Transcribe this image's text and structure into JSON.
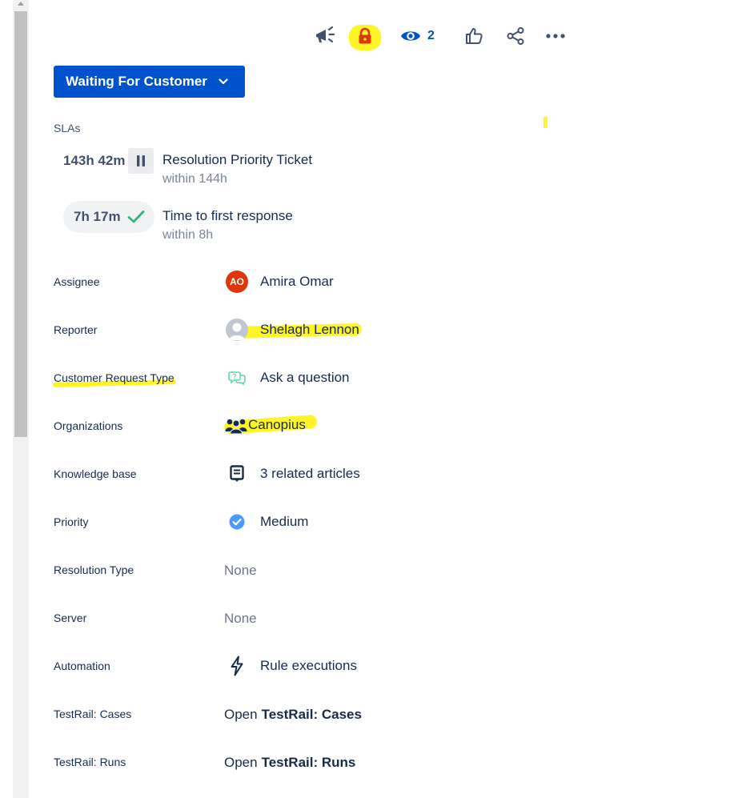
{
  "toolbar": {
    "items": [
      {
        "icon": "megaphone-icon"
      },
      {
        "icon": "lock-icon",
        "color": "#de350b"
      },
      {
        "icon": "eye-icon",
        "count": "2"
      },
      {
        "icon": "thumbs-up-icon"
      },
      {
        "icon": "share-icon"
      },
      {
        "icon": "more-icon"
      }
    ],
    "highlight_color": "#fff200"
  },
  "status": {
    "label": "Waiting For Customer",
    "color": "#0052cc"
  },
  "slas": {
    "title": "SLAs",
    "items": [
      {
        "time": "143h 42m",
        "name": "Resolution Priority Ticket",
        "target": "within 144h",
        "state": "paused"
      },
      {
        "time": "7h 17m",
        "name": "Time to first response",
        "target": "within 8h",
        "state": "met"
      }
    ]
  },
  "fields": {
    "assignee": {
      "label": "Assignee",
      "value": "Amira Omar",
      "initials": "AO",
      "avatar_color": "#de350b"
    },
    "reporter": {
      "label": "Reporter",
      "value": "Shelagh Lennon"
    },
    "request_type": {
      "label": "Customer Request Type",
      "value": "Ask a question"
    },
    "organizations": {
      "label": "Organizations",
      "value": "Canopius"
    },
    "knowledge_base": {
      "label": "Knowledge base",
      "value": "3 related articles"
    },
    "priority": {
      "label": "Priority",
      "value": "Medium"
    },
    "resolution_type": {
      "label": "Resolution Type",
      "value": "None"
    },
    "server": {
      "label": "Server",
      "value": "None"
    },
    "automation": {
      "label": "Automation",
      "value": "Rule executions"
    },
    "testrail_cases": {
      "label": "TestRail: Cases",
      "prefix": "Open",
      "value": "TestRail: Cases"
    },
    "testrail_runs": {
      "label": "TestRail: Runs",
      "prefix": "Open",
      "value": "TestRail: Runs"
    }
  }
}
